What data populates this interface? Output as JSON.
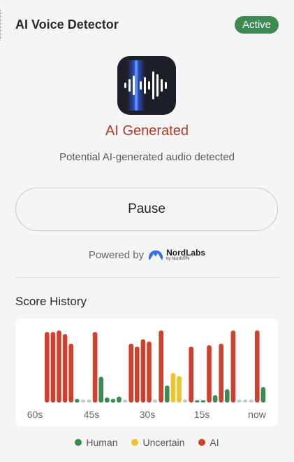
{
  "header": {
    "title": "AI Voice Detector",
    "status": "Active"
  },
  "colors": {
    "accent_green": "#3d8a53",
    "ai_red": "#d0402f",
    "uncertain_yellow": "#f0c22e",
    "human_green": "#3d8a53",
    "no_data_gray": "#c9c9c9",
    "verdict_red": "#b33a2b"
  },
  "detector": {
    "icon": "audio-waveform-icon",
    "verdict": "AI Generated",
    "description": "Potential AI-generated audio detected"
  },
  "controls": {
    "pause_label": "Pause"
  },
  "branding": {
    "powered_by": "Powered by",
    "logo_name": "NordLabs",
    "logo_sub": "by NordVPN",
    "logo_icon": "nordlabs-mountain-icon"
  },
  "history": {
    "title": "Score History",
    "legend": [
      {
        "key": "human",
        "label": "Human",
        "color": "#3d8a53"
      },
      {
        "key": "uncertain",
        "label": "Uncertain",
        "color": "#f0c22e"
      },
      {
        "key": "ai",
        "label": "AI",
        "color": "#d0402f"
      }
    ]
  },
  "chart_data": {
    "type": "bar",
    "x_tick_labels": [
      "60s",
      "45s",
      "30s",
      "15s",
      "now"
    ],
    "ylim": [
      0,
      1
    ],
    "grid": false,
    "legend_placement": "bottom",
    "series": [
      {
        "name": "Human",
        "category": "human"
      },
      {
        "name": "Uncertain",
        "category": "uncertain"
      },
      {
        "name": "AI",
        "category": "ai"
      }
    ],
    "samples": [
      {
        "value": 0.96,
        "category": "ai"
      },
      {
        "value": 0.96,
        "category": "ai"
      },
      {
        "value": 0.98,
        "category": "ai"
      },
      {
        "value": 0.93,
        "category": "ai"
      },
      {
        "value": 0.8,
        "category": "ai"
      },
      {
        "value": 0.05,
        "category": "human"
      },
      {
        "value": 0.04,
        "category": "none"
      },
      {
        "value": 0.04,
        "category": "none"
      },
      {
        "value": 0.96,
        "category": "ai"
      },
      {
        "value": 0.35,
        "category": "human"
      },
      {
        "value": 0.07,
        "category": "human"
      },
      {
        "value": 0.05,
        "category": "human"
      },
      {
        "value": 0.08,
        "category": "human"
      },
      {
        "value": 0.04,
        "category": "none"
      },
      {
        "value": 0.8,
        "category": "ai"
      },
      {
        "value": 0.76,
        "category": "ai"
      },
      {
        "value": 0.86,
        "category": "ai"
      },
      {
        "value": 0.83,
        "category": "ai"
      },
      {
        "value": 0.04,
        "category": "none"
      },
      {
        "value": 0.98,
        "category": "ai"
      },
      {
        "value": 0.23,
        "category": "human"
      },
      {
        "value": 0.4,
        "category": "uncertain"
      },
      {
        "value": 0.36,
        "category": "uncertain"
      },
      {
        "value": 0.04,
        "category": "none"
      },
      {
        "value": 0.76,
        "category": "ai"
      },
      {
        "value": 0.03,
        "category": "human"
      },
      {
        "value": 0.03,
        "category": "human"
      },
      {
        "value": 0.78,
        "category": "ai"
      },
      {
        "value": 0.1,
        "category": "human"
      },
      {
        "value": 0.8,
        "category": "ai"
      },
      {
        "value": 0.18,
        "category": "human"
      },
      {
        "value": 0.98,
        "category": "ai"
      },
      {
        "value": 0.04,
        "category": "none"
      },
      {
        "value": 0.04,
        "category": "none"
      },
      {
        "value": 0.04,
        "category": "none"
      },
      {
        "value": 0.98,
        "category": "ai"
      },
      {
        "value": 0.21,
        "category": "human"
      }
    ]
  }
}
